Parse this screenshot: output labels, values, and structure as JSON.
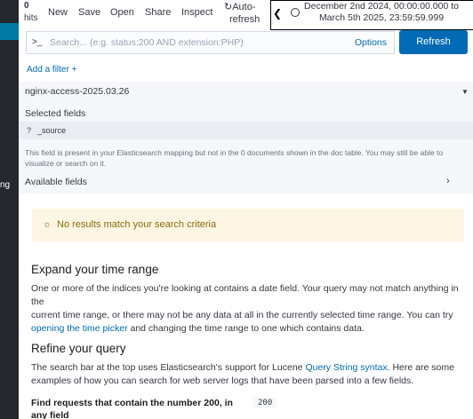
{
  "topbar": {
    "hits_count": "0",
    "hits_label": "hits",
    "menu": [
      "New",
      "Save",
      "Open",
      "Share",
      "Inspect"
    ],
    "autorefresh_line1": "Auto-",
    "autorefresh_line2": "refresh",
    "time_range_line1": "December 2nd 2024, 00:00:00.000 to",
    "time_range_line2": "March 5th 2025, 23:59:59.999"
  },
  "leftnav": {
    "clipped_label": "ng"
  },
  "search": {
    "prompt": ">_",
    "placeholder": "Search... (e.g. status:200 AND extension:PHP)",
    "options_label": "Options",
    "refresh_label": "Refresh"
  },
  "filter": {
    "add_label": "Add a filter",
    "plus": "+"
  },
  "sidebar": {
    "index_pattern": "nginx-access-2025.03.26",
    "selected_fields_title": "Selected fields",
    "source_field_type": "?",
    "source_field_name": "_source",
    "notice_line1": "This field is present in your Elasticsearch mapping but not in the 0 documents shown in the doc table. You may still be able to",
    "notice_line2": "visualize or search on it.",
    "available_fields_title": "Available fields"
  },
  "results": {
    "no_results": "No results match your search criteria",
    "expand_title": "Expand your time range",
    "expand_text_1": "One or more of the indices you're looking at contains a date field. Your query may not match anything in the",
    "expand_text_2": "current time range, or there may not be any data at all in the currently selected time range. You can try",
    "expand_link": "opening the time picker",
    "expand_text_3": " and changing the time range to one which contains data.",
    "refine_title": "Refine your query",
    "refine_text_1": "The search bar at the top uses Elasticsearch's support for Lucene ",
    "refine_link": "Query String syntax",
    "refine_text_2": ". Here are some",
    "refine_text_3": "examples of how you can search for web server logs that have been parsed into a few fields.",
    "find_requests_title": "Find requests that contain the number 200, in any field",
    "find_requests_code": "200"
  },
  "colors": {
    "accent": "#006bb4",
    "nav_bg": "#25282f",
    "warning_bg": "#fef6e5",
    "warning_text": "#8a6a0a"
  }
}
